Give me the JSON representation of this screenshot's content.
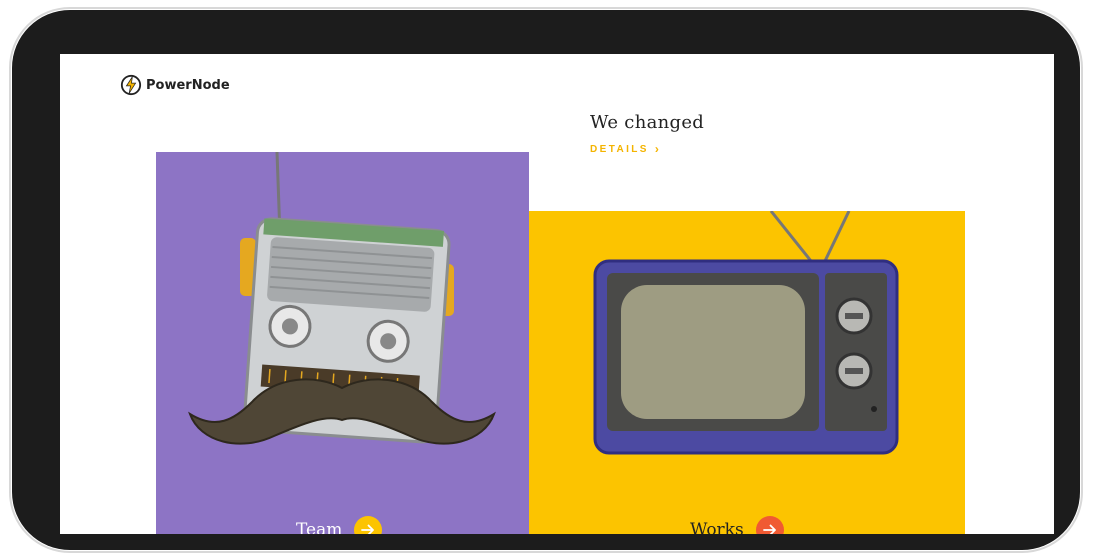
{
  "brand": {
    "name": "PowerNode"
  },
  "hero": {
    "headline": "We changed",
    "details_label": "DETAILS"
  },
  "cards": [
    {
      "label": "Team",
      "background": "#8d74c5",
      "arrow_color": "#fcc400"
    },
    {
      "label": "Works",
      "background": "#fcc400",
      "arrow_color": "#f05a32"
    }
  ],
  "colors": {
    "accent": "#f4b400",
    "device_frame": "#1c1c1c"
  },
  "icons": {
    "logo": "lightning-bolt-icon",
    "details": "chevron-right-icon",
    "card_arrow": "arrow-right-icon"
  }
}
